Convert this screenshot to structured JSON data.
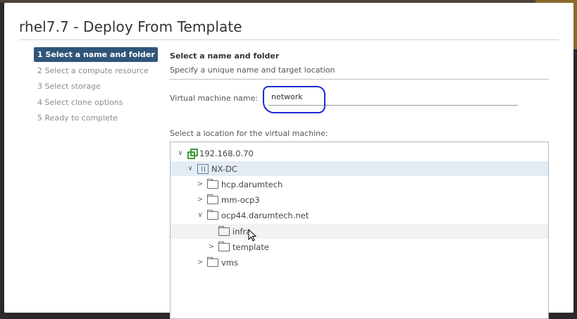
{
  "dialog": {
    "title": "rhel7.7 - Deploy From Template"
  },
  "steps": [
    {
      "label": "1 Select a name and folder",
      "active": true
    },
    {
      "label": "2 Select a compute resource",
      "active": false
    },
    {
      "label": "3 Select storage",
      "active": false
    },
    {
      "label": "4 Select clone options",
      "active": false
    },
    {
      "label": "5 Ready to complete",
      "active": false
    }
  ],
  "main": {
    "section_title": "Select a name and folder",
    "section_subtitle": "Specify a unique name and target location",
    "vm_name_label": "Virtual machine name:",
    "vm_name_value": "network",
    "location_label": "Select a location for the virtual machine:"
  },
  "tree": [
    {
      "label": "192.168.0.70",
      "icon": "vcenter-icon",
      "caret": "expanded",
      "selected": false
    },
    {
      "label": "NX-DC",
      "icon": "datacenter-icon",
      "caret": "expanded",
      "selected": true
    },
    {
      "label": "hcp.darumtech",
      "icon": "folder-icon",
      "caret": "collapsed",
      "selected": false
    },
    {
      "label": "mm-ocp3",
      "icon": "folder-icon",
      "caret": "collapsed",
      "selected": false
    },
    {
      "label": "ocp44.darumtech.net",
      "icon": "folder-icon",
      "caret": "expanded",
      "selected": false
    },
    {
      "label": "infra",
      "icon": "folder-icon",
      "caret": "none",
      "selected": false,
      "hover": true
    },
    {
      "label": "template",
      "icon": "folder-icon",
      "caret": "collapsed",
      "selected": false
    },
    {
      "label": "vms",
      "icon": "folder-icon",
      "caret": "collapsed",
      "selected": false
    }
  ],
  "colors": {
    "active_step_bg": "#30567a",
    "selected_row_bg": "#e4ecf3",
    "annotation": "#1f2bd1",
    "vcenter_icon": "#3d9b3a"
  }
}
